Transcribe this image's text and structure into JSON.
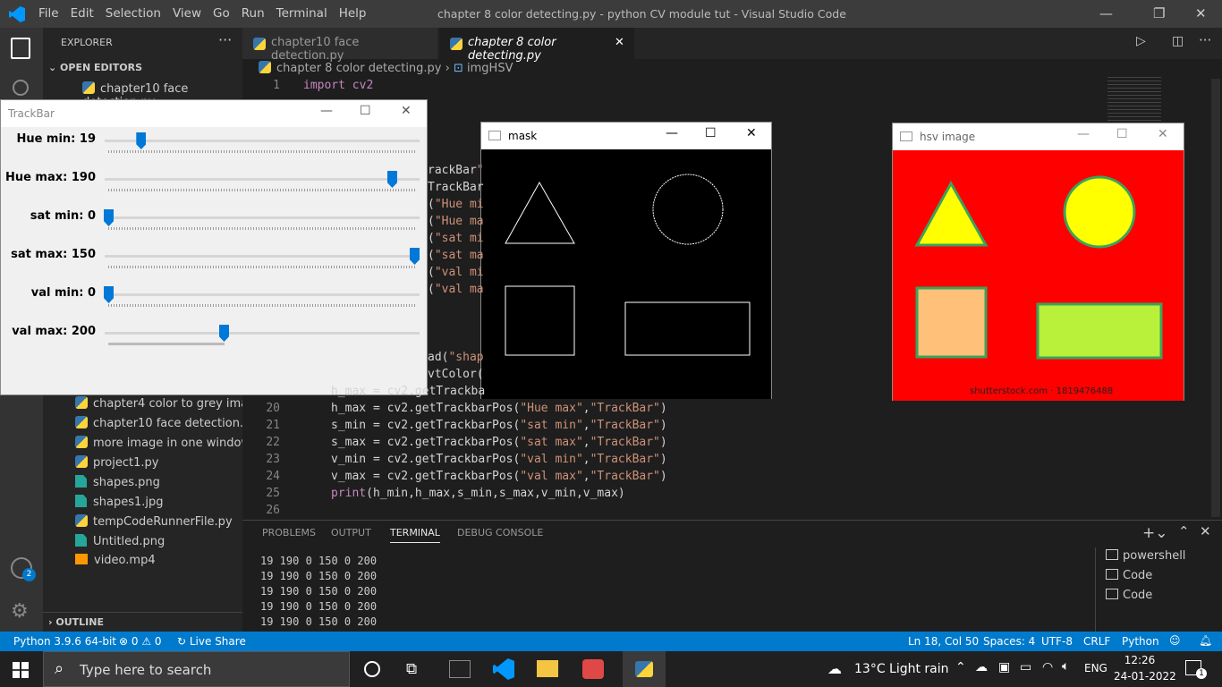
{
  "titlebar": {
    "menu": [
      "File",
      "Edit",
      "Selection",
      "View",
      "Go",
      "Run",
      "Terminal",
      "Help"
    ],
    "title": "chapter 8 color detecting.py - python CV module tut - Visual Studio Code"
  },
  "sidebar": {
    "header": "EXPLORER",
    "open_editors": "OPEN EDITORS",
    "open_file": "chapter10 face detection.py",
    "files": [
      "chapter4 color to grey ima...",
      "chapter10 face detection.py",
      "more image in one window....",
      "project1.py",
      "shapes.png",
      "shapes1.jpg",
      "tempCodeRunnerFile.py",
      "Untitled.png",
      "video.mp4"
    ],
    "outline": "OUTLINE",
    "accounts_badge": "2"
  },
  "tabs": [
    {
      "label": "chapter10 face detection.py"
    },
    {
      "label": "chapter 8 color detecting.py",
      "close": "✕"
    }
  ],
  "breadcrumb": {
    "file": "chapter 8 color detecting.py",
    "symbol": "imgHSV"
  },
  "code_lines": [
    {
      "n": "1",
      "text": "import cv2"
    },
    {
      "n": "",
      "text": "rackBar\""
    },
    {
      "n": "",
      "text": "TrackBar"
    },
    {
      "n": "",
      "text": "(\"Hue mi"
    },
    {
      "n": "",
      "text": "(\"Hue ma"
    },
    {
      "n": "",
      "text": "(\"sat mi"
    },
    {
      "n": "",
      "text": "(\"sat ma"
    },
    {
      "n": "",
      "text": "(\"val mi"
    },
    {
      "n": "",
      "text": "(\"val ma"
    },
    {
      "n": "",
      "text": "ad(\"shap"
    },
    {
      "n": "",
      "text": "vtColor("
    },
    {
      "n": "",
      "text": "h_max = cv2.getTrackba"
    },
    {
      "n": "20",
      "text": "h_max = cv2.getTrackbarPos(\"Hue max\",\"TrackBar\")"
    },
    {
      "n": "21",
      "text": "s_min = cv2.getTrackbarPos(\"sat min\",\"TrackBar\")"
    },
    {
      "n": "22",
      "text": "s_max = cv2.getTrackbarPos(\"sat max\",\"TrackBar\")"
    },
    {
      "n": "23",
      "text": "v_min = cv2.getTrackbarPos(\"val min\",\"TrackBar\")"
    },
    {
      "n": "24",
      "text": "v_max = cv2.getTrackbarPos(\"val max\",\"TrackBar\")"
    },
    {
      "n": "25",
      "text": "print(h_min,h_max,s_min,s_max,v_min,v_max)"
    },
    {
      "n": "26",
      "text": ""
    }
  ],
  "panel": {
    "tabs": [
      "PROBLEMS",
      "OUTPUT",
      "TERMINAL",
      "DEBUG CONSOLE"
    ],
    "active": "TERMINAL",
    "output": [
      "19 190 0 150 0 200",
      "19 190 0 150 0 200",
      "19 190 0 150 0 200",
      "19 190 0 150 0 200",
      "19 190 0 150 0 200"
    ],
    "terminals": [
      "powershell",
      "Code",
      "Code"
    ]
  },
  "trackbar": {
    "title": "TrackBar",
    "sliders": [
      {
        "label": "Hue min: 19",
        "value": 19,
        "max": 179
      },
      {
        "label": "Hue max: 190",
        "value": 190,
        "max": 205
      },
      {
        "label": "sat min: 0",
        "value": 0,
        "max": 255
      },
      {
        "label": "sat max: 150",
        "value": 150,
        "max": 150
      },
      {
        "label": "val min: 0",
        "value": 0,
        "max": 255
      },
      {
        "label": "val max: 200",
        "value": 200,
        "max": 255
      }
    ]
  },
  "mask_window": {
    "title": "mask"
  },
  "hsv_window": {
    "title": "hsv image",
    "watermark": "shutterstock.com · 1819476488"
  },
  "statusbar": {
    "python": "Python 3.9.6 64-bit",
    "errors": "⊗ 0 ⚠ 0",
    "liveshare": "Live Share",
    "position": "Ln 18, Col 50",
    "spaces": "Spaces: 4",
    "encoding": "UTF-8",
    "eol": "CRLF",
    "language": "Python"
  },
  "taskbar": {
    "search_placeholder": "Type here to search",
    "weather": "13°C  Light rain",
    "lang": "ENG",
    "time": "12:26",
    "date": "24-01-2022",
    "notif": "1"
  },
  "colors": {
    "accent": "#007acc",
    "hsv_bg": "#ff0000",
    "slider_thumb": "#0078d7"
  }
}
